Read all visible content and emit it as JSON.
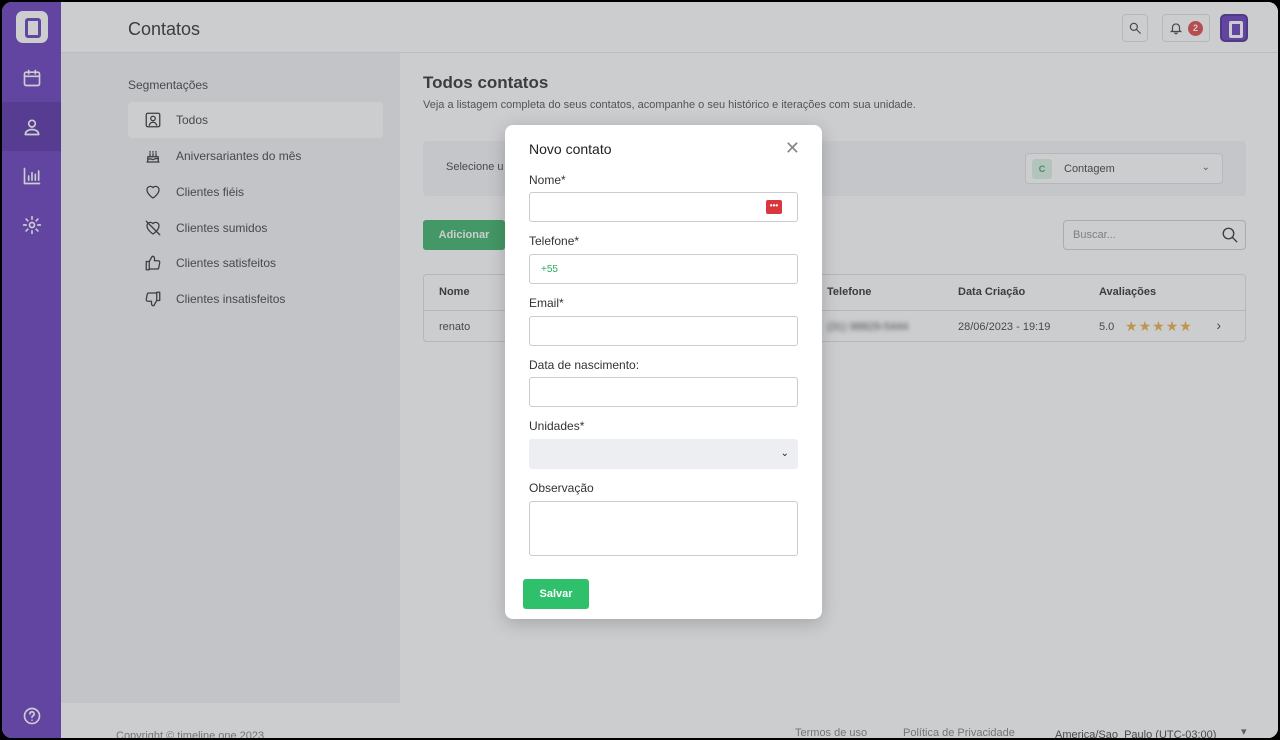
{
  "header": {
    "title": "Contatos",
    "notifications_count": "2"
  },
  "segments": {
    "heading": "Segmentações",
    "items": [
      {
        "label": "Todos",
        "icon": "user-square-icon",
        "active": true
      },
      {
        "label": "Aniversariantes do mês",
        "icon": "cake-icon"
      },
      {
        "label": "Clientes fiéis",
        "icon": "heart-icon"
      },
      {
        "label": "Clientes sumidos",
        "icon": "heart-off-icon"
      },
      {
        "label": "Clientes satisfeitos",
        "icon": "thumbs-up-icon"
      },
      {
        "label": "Clientes insatisfeitos",
        "icon": "thumbs-down-icon"
      }
    ]
  },
  "main": {
    "title": "Todos contatos",
    "description": "Veja a listagem completa do seus contatos, acompanhe o seu histórico e iterações com sua unidade.",
    "unit_label": "Selecione u",
    "unit_badge": "C",
    "unit_value": "Contagem",
    "add_button": "Adicionar",
    "search_placeholder": "Buscar...",
    "table": {
      "columns": [
        "Nome",
        "Telefone",
        "Data Criação",
        "Avaliações"
      ],
      "rows": [
        {
          "name": "renato",
          "phone": "(31) 98829-5444",
          "created": "28/06/2023 - 19:19",
          "rating": "5.0",
          "stars": 5
        }
      ]
    }
  },
  "footer": {
    "copyright": "Copyright © timeline one 2023",
    "terms": "Termos de uso",
    "privacy": "Política de Privacidade",
    "timezone": "America/Sao_Paulo (UTC-03:00)"
  },
  "modal": {
    "title": "Novo contato",
    "fields": {
      "name_label": "Nome*",
      "phone_label": "Telefone*",
      "phone_prefix": "+55",
      "email_label": "Email*",
      "birth_label": "Data de nascimento:",
      "units_label": "Unidades*",
      "note_label": "Observação"
    },
    "save_button": "Salvar"
  },
  "colors": {
    "brand": "#5b2fb8",
    "primary_green": "#2eac5e",
    "star": "#e8a93a",
    "alert": "#e03b3b"
  }
}
